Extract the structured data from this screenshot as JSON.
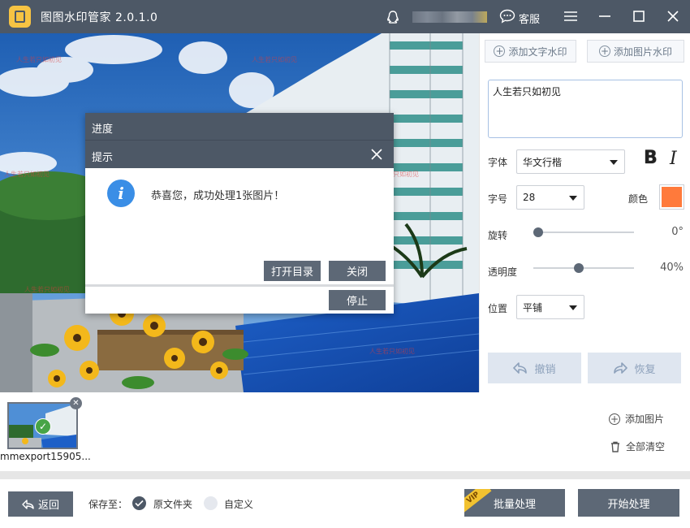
{
  "app": {
    "title": "图图水印管家  2.0.1.0",
    "service_label": "客服"
  },
  "preview": {
    "watermark_text": "人生若只如初见"
  },
  "dialog": {
    "progress_title": "进度",
    "tip_title": "提示",
    "message": "恭喜您，成功处理1张图片！",
    "open_dir_label": "打开目录",
    "close_label": "关闭",
    "stop_label": "停止"
  },
  "panel": {
    "add_text_label": "添加文字水印",
    "add_image_label": "添加图片水印",
    "text_value": "人生若只如初见",
    "font_label": "字体",
    "font_value": "华文行楷",
    "bold_glyph": "B",
    "italic_glyph": "I",
    "size_label": "字号",
    "size_value": "28",
    "color_label": "颜色",
    "color_value": "#ff7a3b",
    "rotate_label": "旋转",
    "rotate_value": "0°",
    "rotate_fraction": 0.0,
    "opacity_label": "透明度",
    "opacity_value": "40%",
    "opacity_fraction": 0.4,
    "position_label": "位置",
    "position_value": "平铺",
    "undo_label": "撤销",
    "redo_label": "恢复"
  },
  "strip": {
    "thumb_name": "mmexport15905...",
    "add_image_label": "添加图片",
    "clear_all_label": "全部清空"
  },
  "bottom": {
    "back_label": "返回",
    "save_to_label": "保存至：",
    "original_folder_label": "原文件夹",
    "custom_label": "自定义",
    "vip_badge": "VIP",
    "batch_label": "批量处理",
    "start_label": "开始处理"
  }
}
